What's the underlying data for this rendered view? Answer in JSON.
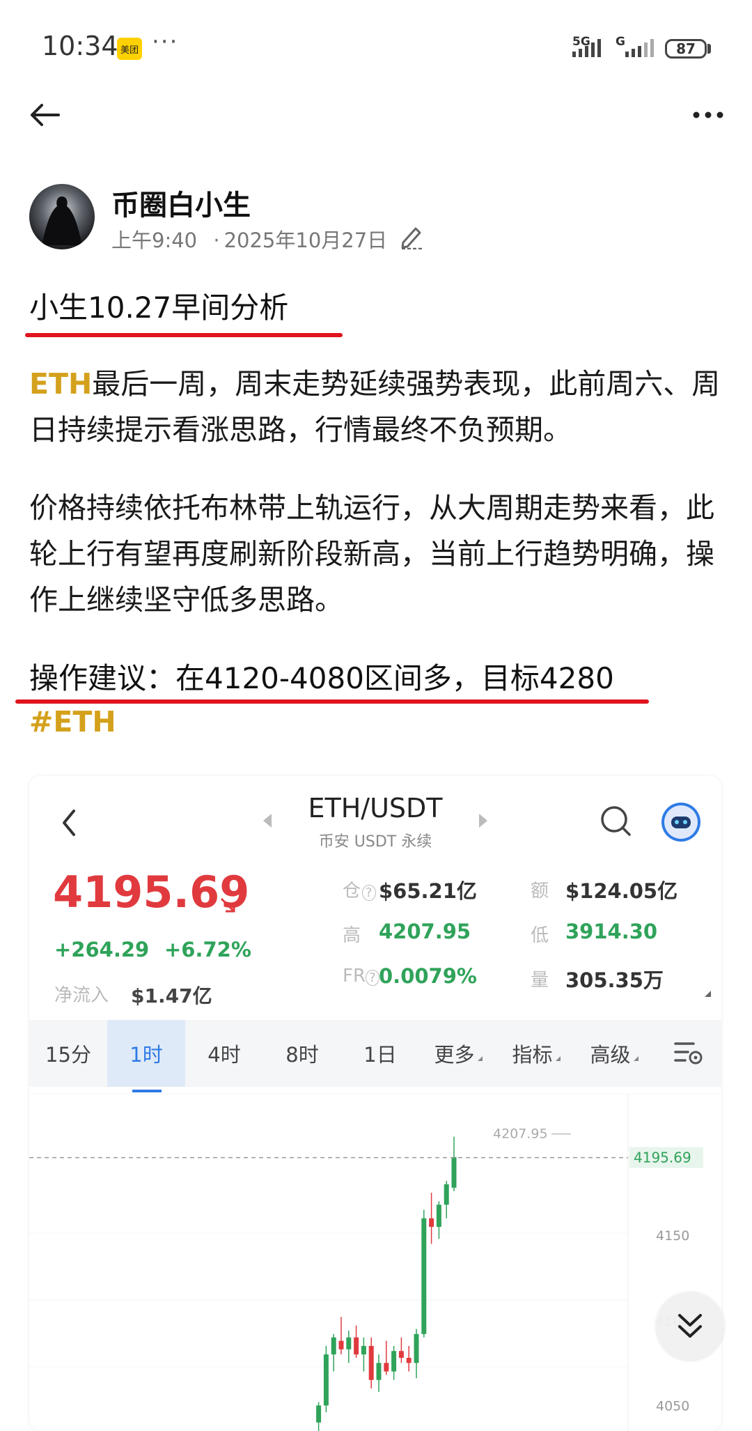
{
  "status_bar": {
    "time": "10:34",
    "app_badge": "美团",
    "more": "···",
    "net1": "5G",
    "net2": "G",
    "battery": "87"
  },
  "nav": {
    "back_icon": "back-arrow-icon",
    "more_icon": "more-horizontal-icon"
  },
  "author": {
    "name": "币圈白小生",
    "time": "上午9:40",
    "separator": "·",
    "date": "2025年10月27日"
  },
  "post": {
    "title": "小生10.27早间分析",
    "p1_highlight": "ETH",
    "p1_rest": "最后一周，周末走势延续强势表现，此前周六、周日持续提示看涨思路，行情最终不负预期。",
    "p2": "价格持续依托布林带上轨运行，从大周期走势来看，此轮上行有望再度刷新阶段新高，当前上行趋势明确，操作上继续坚守低多思路。",
    "advice": "操作建议：在4120-4080区间多，目标4280",
    "hashtag": "#ETH",
    "underline_color": "#e0141e",
    "accent_color": "#d4a11c"
  },
  "card": {
    "pair": "ETH/USDT",
    "pair_sub": "币安 USDT 永续",
    "price": "4195.69",
    "change_abs": "+264.29",
    "change_pct": "+6.72%",
    "netflow_label": "净流入",
    "netflow_value": "$1.47亿",
    "stats": {
      "oi_label": "仓",
      "oi_value": "$65.21亿",
      "turnover_label": "额",
      "turnover_value": "$124.05亿",
      "high_label": "高",
      "high_value": "4207.95",
      "low_label": "低",
      "low_value": "3914.30",
      "fr_label": "FR",
      "fr_value": "0.0079%",
      "vol_label": "量",
      "vol_value": "305.35万"
    },
    "timeframes": [
      "15分",
      "1时",
      "4时",
      "8时",
      "1日",
      "更多",
      "指标",
      "高级"
    ],
    "active_timeframe": "1时",
    "colors": {
      "up": "#2fa35a",
      "down": "#e03a3e",
      "accent": "#2f7be6"
    }
  },
  "chart_data": {
    "type": "candlestick",
    "y_ticks": [
      "4195.69",
      "4150",
      "4100",
      "4050"
    ],
    "ylim": [
      4035,
      4225
    ],
    "high_marker": "4207.95",
    "last_price": "4195.69",
    "candles": [
      {
        "o": 4040,
        "h": 4052,
        "l": 4035,
        "c": 4050
      },
      {
        "o": 4050,
        "h": 4085,
        "l": 4046,
        "c": 4080
      },
      {
        "o": 4080,
        "h": 4092,
        "l": 4070,
        "c": 4090
      },
      {
        "o": 4088,
        "h": 4102,
        "l": 4080,
        "c": 4083
      },
      {
        "o": 4083,
        "h": 4094,
        "l": 4075,
        "c": 4090
      },
      {
        "o": 4090,
        "h": 4097,
        "l": 4078,
        "c": 4080
      },
      {
        "o": 4080,
        "h": 4090,
        "l": 4070,
        "c": 4085
      },
      {
        "o": 4085,
        "h": 4090,
        "l": 4060,
        "c": 4065
      },
      {
        "o": 4065,
        "h": 4080,
        "l": 4058,
        "c": 4075
      },
      {
        "o": 4075,
        "h": 4088,
        "l": 4068,
        "c": 4070
      },
      {
        "o": 4070,
        "h": 4085,
        "l": 4065,
        "c": 4082
      },
      {
        "o": 4082,
        "h": 4090,
        "l": 4075,
        "c": 4078
      },
      {
        "o": 4078,
        "h": 4085,
        "l": 4070,
        "c": 4075
      },
      {
        "o": 4075,
        "h": 4095,
        "l": 4066,
        "c": 4092
      },
      {
        "o": 4092,
        "h": 4165,
        "l": 4090,
        "c": 4160
      },
      {
        "o": 4160,
        "h": 4175,
        "l": 4145,
        "c": 4155
      },
      {
        "o": 4155,
        "h": 4170,
        "l": 4148,
        "c": 4168
      },
      {
        "o": 4168,
        "h": 4182,
        "l": 4160,
        "c": 4180
      },
      {
        "o": 4178,
        "h": 4208,
        "l": 4176,
        "c": 4196
      }
    ]
  },
  "scroll": {
    "icon": "double-chevron-down-icon"
  }
}
